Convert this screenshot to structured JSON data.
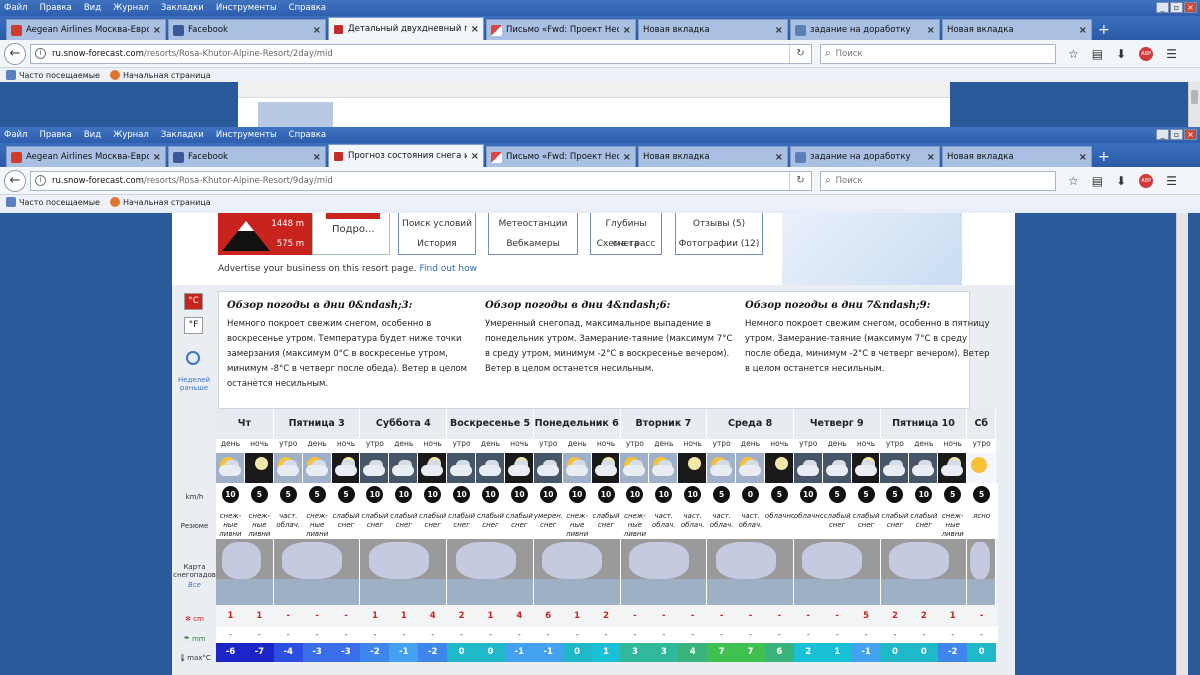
{
  "menu": [
    "Файл",
    "Правка",
    "Вид",
    "Журнал",
    "Закладки",
    "Инструменты",
    "Справка"
  ],
  "win1": {
    "tabs": [
      {
        "label": "Aegean Airlines Москва-Евро...",
        "icon": "r"
      },
      {
        "label": "Facebook",
        "icon": "fb"
      },
      {
        "label": "Детальный двухдневный п...",
        "icon": "sf",
        "active": true
      },
      {
        "label": "Письмо «Fwd: Проект Неста...",
        "icon": "gm"
      },
      {
        "label": "Новая вкладка",
        "icon": ""
      },
      {
        "label": "задание на доработку",
        "icon": "doc"
      },
      {
        "label": "Новая вкладка",
        "icon": ""
      }
    ],
    "url_host": "ru.snow-forecast.com",
    "url_path": "/resorts/Rosa-Khutor-Alpine-Resort/2day/mid"
  },
  "win2": {
    "tabs": [
      {
        "label": "Aegean Airlines Москва-Евро...",
        "icon": "r"
      },
      {
        "label": "Facebook",
        "icon": "fb"
      },
      {
        "label": "Прогноз состояния снега и ...",
        "icon": "sf",
        "active": true
      },
      {
        "label": "Письмо «Fwd: Проект Неста...",
        "icon": "gm"
      },
      {
        "label": "Новая вкладка",
        "icon": ""
      },
      {
        "label": "задание на доработку",
        "icon": "doc"
      },
      {
        "label": "Новая вкладка",
        "icon": ""
      }
    ],
    "url_host": "ru.snow-forecast.com",
    "url_path": "/resorts/Rosa-Khutor-Alpine-Resort/9day/mid"
  },
  "search_placeholder": "Поиск",
  "bookmarks": [
    "Часто посещаемые",
    "Начальная страница"
  ],
  "resort": {
    "alt_top": "1448 m",
    "alt_bottom": "575 m",
    "podro": "Подро..."
  },
  "links": [
    {
      "top": "Поиск условий",
      "bottom": "История"
    },
    {
      "top": "Метеостанции",
      "bottom": "Вебкамеры"
    },
    {
      "top": "Глубины снега",
      "bottom": "Схема трасс"
    },
    {
      "top": "Отзывы (5)",
      "bottom": "Фотографии (12)"
    }
  ],
  "advertise": {
    "text": "Advertise your business on this resort page.",
    "link": "Find out how"
  },
  "units": {
    "c": "°C",
    "f": "°F"
  },
  "earlier": "Неделей раньше",
  "row_labels": {
    "wind": "km/h",
    "summary": "Резюме",
    "map": "Карта снегопадов",
    "map_all": "Все",
    "snow": "cm",
    "rain": "mm",
    "temp": "max°C"
  },
  "summaries": [
    {
      "title": "Обзор погоды в дни 0&ndash;3:",
      "text": "Немного покроет свежим снегом, особенно в воскресенье утром. Температура будет ниже точки замерзания (максимум 0°C в воскресенье утром, минимум -8°C в четверг после обеда). Ветер в целом останется несильным."
    },
    {
      "title": "Обзор погоды в дни 4&ndash;6:",
      "text": "Умеренный снегопад, максимальное выпадение в понедельник утром. Замерание-таяние (максимум 7°C в среду утром, минимум -2°C в воскресенье вечером). Ветер в целом останется несильным."
    },
    {
      "title": "Обзор погоды в дни 7&ndash;9:",
      "text": "Немного покроет свежим снегом, особенно в пятницу утром. Замерание-таяние (максимум 7°C в среду после обеда, минимум -2°C в четверг вечером). Ветер в целом останется несильным."
    }
  ],
  "days": [
    {
      "name": "Чт",
      "slots": [
        "день",
        "ночь"
      ]
    },
    {
      "name": "Пятница 3",
      "slots": [
        "утро",
        "день",
        "ночь"
      ]
    },
    {
      "name": "Суббота 4",
      "slots": [
        "утро",
        "день",
        "ночь"
      ]
    },
    {
      "name": "Воскресенье 5",
      "slots": [
        "утро",
        "день",
        "ночь"
      ]
    },
    {
      "name": "Понедельник 6",
      "slots": [
        "утро",
        "день",
        "ночь"
      ]
    },
    {
      "name": "Вторник 7",
      "slots": [
        "утро",
        "день",
        "ночь"
      ]
    },
    {
      "name": "Среда 8",
      "slots": [
        "утро",
        "день",
        "ночь"
      ]
    },
    {
      "name": "Четверг 9",
      "slots": [
        "утро",
        "день",
        "ночь"
      ]
    },
    {
      "name": "Пятница 10",
      "slots": [
        "утро",
        "день",
        "ночь"
      ]
    },
    {
      "name": "Сб",
      "slots": [
        "утро"
      ]
    }
  ],
  "icons": [
    "sun-cloud",
    "moon",
    "sun-cloud",
    "sun-cloud",
    "night-cloud",
    "cloud",
    "cloud",
    "night-cloud",
    "cloud",
    "cloud",
    "night-cloud",
    "cloud",
    "sun-cloud",
    "night-cloud",
    "sun-cloud",
    "sun-cloud",
    "moon",
    "sun-cloud",
    "sun-cloud",
    "moon",
    "cloud",
    "cloud",
    "night-cloud",
    "cloud",
    "cloud",
    "night-cloud",
    "sun"
  ],
  "wind": [
    "10",
    "5",
    "5",
    "5",
    "5",
    "10",
    "10",
    "10",
    "10",
    "10",
    "10",
    "10",
    "10",
    "10",
    "10",
    "10",
    "10",
    "5",
    "0",
    "5",
    "10",
    "5",
    "5",
    "5",
    "10",
    "5",
    "5"
  ],
  "desc": [
    "снеж-ные ливни",
    "снеж-ные ливни",
    "част. облач.",
    "снеж-ные ливни",
    "слабый снег",
    "слабый снег",
    "слабый снег",
    "слабый снег",
    "слабый снег",
    "слабый снег",
    "слабый снег",
    "умерен. снег",
    "снеж-ные ливни",
    "слабый снег",
    "снеж-ные ливни",
    "част. облач.",
    "част. облач.",
    "част. облач.",
    "част. облач.",
    "облачно",
    "облачно",
    "слабый снег",
    "слабый снег",
    "слабый снег",
    "слабый снег",
    "снеж-ные ливни",
    "ясно"
  ],
  "snow": [
    "1",
    "1",
    "-",
    "-",
    "-",
    "1",
    "1",
    "4",
    "2",
    "1",
    "4",
    "6",
    "1",
    "2",
    "-",
    "-",
    "-",
    "-",
    "-",
    "-",
    "-",
    "-",
    "5",
    "2",
    "2",
    "1",
    "-"
  ],
  "rain": [
    "-",
    "-",
    "-",
    "-",
    "-",
    "-",
    "-",
    "-",
    "-",
    "-",
    "-",
    "-",
    "-",
    "-",
    "-",
    "-",
    "-",
    "-",
    "-",
    "-",
    "-",
    "-",
    "-",
    "-",
    "-",
    "-",
    "-"
  ],
  "temp": [
    "-6",
    "-7",
    "-4",
    "-3",
    "-3",
    "-2",
    "-1",
    "-2",
    "0",
    "0",
    "-1",
    "-1",
    "0",
    "1",
    "3",
    "3",
    "4",
    "7",
    "7",
    "6",
    "2",
    "1",
    "-1",
    "0",
    "0",
    "-2",
    "0"
  ],
  "temp_colors": [
    "#1c25c8",
    "#1c25c8",
    "#2b4fe3",
    "#3a6de8",
    "#3a6de8",
    "#3e86ec",
    "#44a1ef",
    "#3e86ec",
    "#1eb8c9",
    "#1eb8c9",
    "#44a1ef",
    "#44a1ef",
    "#1eb8c9",
    "#19c0d6",
    "#2fb89a",
    "#2fb89a",
    "#3ab27c",
    "#40c050",
    "#40c050",
    "#3ab27c",
    "#19c0d6",
    "#19c0d6",
    "#44a1ef",
    "#1eb8c9",
    "#1eb8c9",
    "#3e86ec",
    "#1eb8c9"
  ]
}
